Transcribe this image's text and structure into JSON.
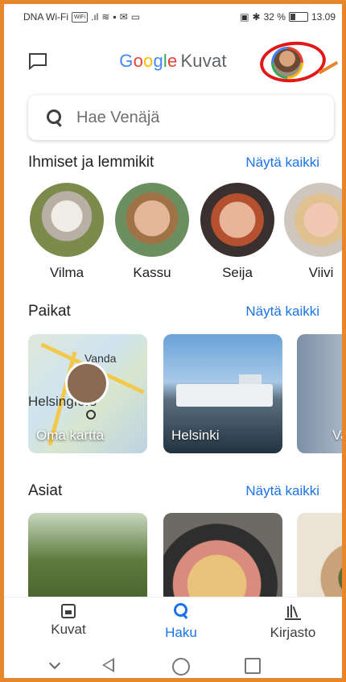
{
  "status_bar": {
    "carrier": "DNA Wi-Fi",
    "battery": "32 %",
    "time": "13.09"
  },
  "app_bar": {
    "logo_letters": [
      "G",
      "o",
      "o",
      "g",
      "l",
      "e"
    ],
    "product": "Kuvat",
    "icons": [
      "chat-icon",
      "account-avatar"
    ]
  },
  "search": {
    "placeholder": "Hae Venäjä"
  },
  "people_section": {
    "title": "Ihmiset ja lemmikit",
    "show_all": "Näytä kaikki",
    "people": [
      {
        "name": "Vilma"
      },
      {
        "name": "Kassu"
      },
      {
        "name": "Seija"
      },
      {
        "name": "Viivi"
      }
    ]
  },
  "places_section": {
    "title": "Paikat",
    "show_all": "Näytä kaikki",
    "cards": [
      {
        "label": "Oma kartta",
        "map_texts": [
          "Vanda",
          "Helsingfors"
        ]
      },
      {
        "label": "Helsinki"
      },
      {
        "label": "Va"
      }
    ]
  },
  "things_section": {
    "title": "Asiat",
    "show_all": "Näytä kaikki"
  },
  "bottom_nav": {
    "items": [
      {
        "label": "Kuvat",
        "icon": "photo-icon",
        "active": false
      },
      {
        "label": "Haku",
        "icon": "search-icon",
        "active": true
      },
      {
        "label": "Kirjasto",
        "icon": "library-icon",
        "active": false
      }
    ]
  },
  "colors": {
    "accent": "#1a73e8",
    "frame": "#e8862b",
    "annotation": "#e21818"
  }
}
